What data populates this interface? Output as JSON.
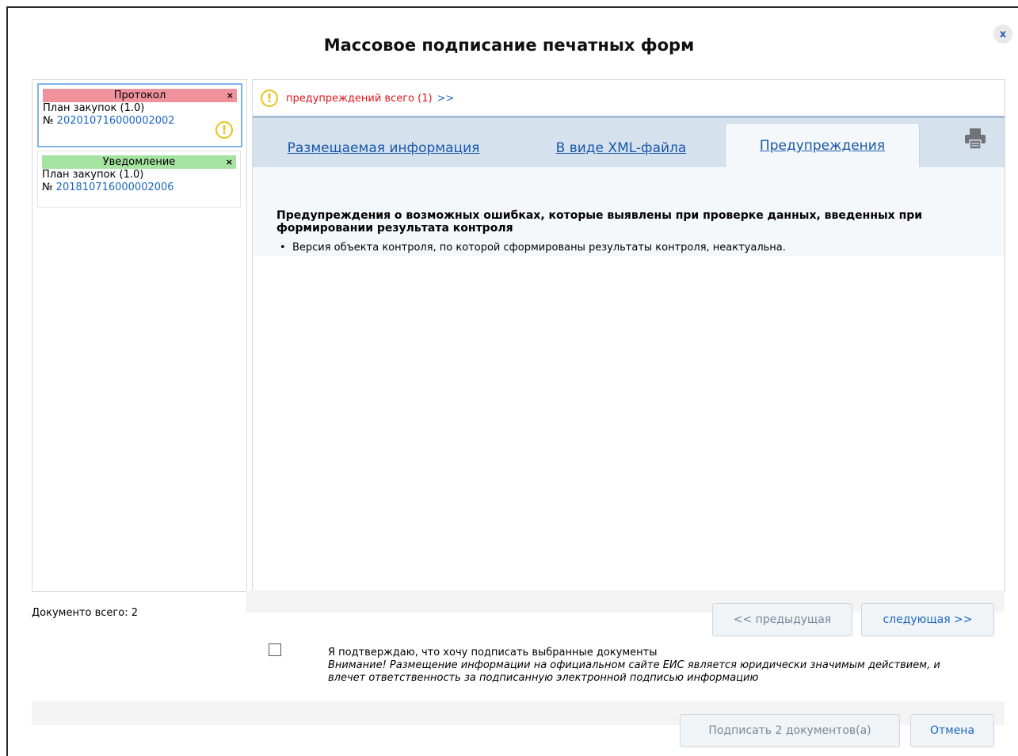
{
  "dialog": {
    "title": "Массовое подписание печатных форм",
    "close_label": "x"
  },
  "documents": [
    {
      "type": "Протокол",
      "type_color": "#f0929b",
      "plan": "План закупок (1.0)",
      "number_prefix": "№",
      "number": "202010716000002002",
      "has_warning": true,
      "close": "×"
    },
    {
      "type": "Уведомление",
      "type_color": "#a5e3a1",
      "plan": "План закупок (1.0)",
      "number_prefix": "№",
      "number": "201810716000002006",
      "has_warning": false,
      "close": "×"
    }
  ],
  "warnings_bar": {
    "icon": "warning-icon",
    "text": "предупреждений всего (1)",
    "more": ">>"
  },
  "tabs": [
    {
      "label": "Размещаемая информация",
      "active": false
    },
    {
      "label": "В виде XML-файла",
      "active": false
    },
    {
      "label": "Предупреждения",
      "active": true
    }
  ],
  "print_icon": "printer-icon",
  "content": {
    "heading": "Предупреждения о возможных ошибках, которые выявлены при проверке данных, введенных при формировании результата контроля",
    "items": [
      "Версия объекта контроля, по которой сформированы результаты контроля, неактуальна."
    ]
  },
  "footer": {
    "doc_count": "Документо всего: 2",
    "prev_label": "<< предыдущая",
    "next_label": "следующая >>",
    "confirm_text": "Я подтверждаю, что хочу подписать выбранные документы",
    "confirm_note": "Внимание! Размещение информации на официальном сайте ЕИС является юридически значимым действием, и влечет ответственность за подписанную электронной подписью информацию",
    "sign_label": "Подписать 2 документов(а)",
    "cancel_label": "Отмена"
  },
  "colors": {
    "link": "#1a66c0",
    "warning_text": "#e0161a",
    "warning_icon": "#e8c318",
    "tab_bg": "#d5e2ee"
  }
}
